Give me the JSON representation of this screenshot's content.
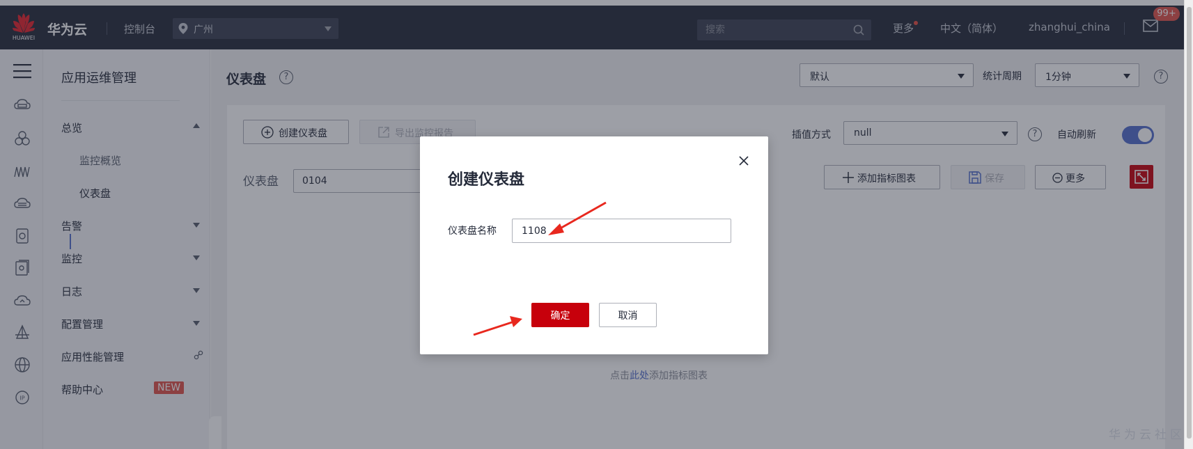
{
  "topbar": {
    "logo_text": "HUAWEI",
    "brand": "华为云",
    "console": "控制台",
    "region": "广州",
    "search_placeholder": "搜索",
    "more": "更多",
    "language": "中文（简体）",
    "username": "zhanghui_china",
    "mail_badge": "99+"
  },
  "rail_icons": [
    "menu-icon",
    "cloud-server-icon",
    "cluster-icon",
    "monitoring-icon",
    "cloud-storage-icon",
    "database-icon",
    "document-icon",
    "cloud-icon",
    "network-icon",
    "globe-icon",
    "ip-icon"
  ],
  "sidemenu": {
    "title": "应用运维管理",
    "items": [
      {
        "label": "总览",
        "expanded": true
      },
      {
        "label": "告警"
      },
      {
        "label": "监控"
      },
      {
        "label": "日志"
      },
      {
        "label": "配置管理"
      },
      {
        "label": "应用性能管理"
      },
      {
        "label": "帮助中心",
        "tag": "NEW"
      }
    ],
    "subitems": [
      {
        "label": "监控概览"
      },
      {
        "label": "仪表盘",
        "active": true
      }
    ]
  },
  "main": {
    "title": "仪表盘",
    "view_select": "默认",
    "period_label": "统计周期",
    "period_select": "1分钟",
    "toolbar": {
      "create_label": "创建仪表盘",
      "export_label": "导出监控报告",
      "interp_label": "插值方式",
      "interp_select": "null",
      "auto_refresh_label": "自动刷新",
      "auto_refresh_on": true
    },
    "dashboard_label": "仪表盘",
    "dashboard_value": "0104",
    "actions": {
      "add_chart": "添加指标图表",
      "save": "保存",
      "more": "更多"
    },
    "empty_prefix": "点击",
    "empty_link": "此处",
    "empty_suffix": "添加指标图表"
  },
  "dialog": {
    "title": "创建仪表盘",
    "field_label": "仪表盘名称",
    "field_value": "1108",
    "confirm": "确定",
    "cancel": "取消"
  },
  "watermark": "华为云社区",
  "colors": {
    "topbar_bg": "#252b3a",
    "primary_red": "#c7000b",
    "accent_blue": "#526ecc",
    "badge_red": "#e0534a"
  }
}
